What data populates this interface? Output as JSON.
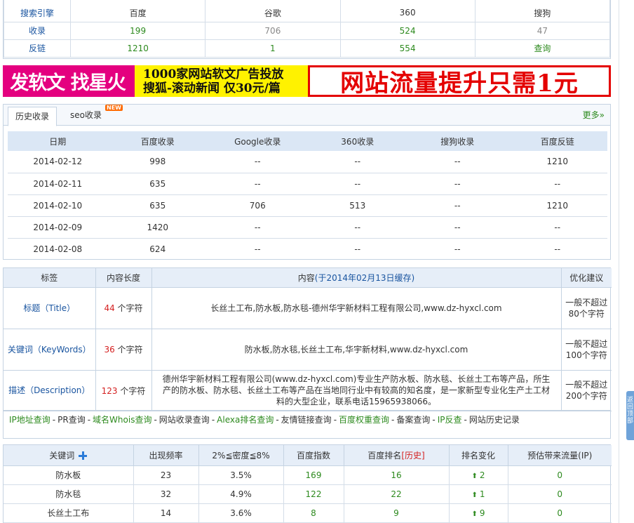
{
  "top_stats": {
    "headers": [
      "搜索引擎",
      "百度",
      "谷歌",
      "360",
      "搜狗"
    ],
    "index_row": {
      "label": "收录",
      "values": [
        "199",
        "706",
        "524",
        "47"
      ]
    },
    "backlink_row": {
      "label": "反链",
      "values": [
        "1210",
        "1",
        "554",
        "查询"
      ]
    }
  },
  "banner": {
    "left_text": "发软文 找星火",
    "mid_line1": "1000家网站软文广告投放",
    "mid_line2": "搜狐-滚动新闻 仅30元/篇",
    "right_text": "网站流量提升只需1元"
  },
  "history": {
    "tabs": [
      "历史收录",
      "seo收录"
    ],
    "new_badge": "NEW",
    "more": "更多»",
    "columns": [
      "日期",
      "百度收录",
      "Google收录",
      "360收录",
      "搜狗收录",
      "百度反链"
    ],
    "rows": [
      [
        "2014-02-12",
        "998",
        "--",
        "--",
        "--",
        "1210"
      ],
      [
        "2014-02-11",
        "635",
        "--",
        "--",
        "--",
        "--"
      ],
      [
        "2014-02-10",
        "635",
        "706",
        "513",
        "--",
        "1210"
      ],
      [
        "2014-02-09",
        "1420",
        "--",
        "--",
        "--",
        "--"
      ],
      [
        "2014-02-08",
        "624",
        "--",
        "--",
        "--",
        "--"
      ]
    ]
  },
  "meta": {
    "col_tag": "标签",
    "col_len": "内容长度",
    "col_content_prefix": "内容",
    "col_content_cache": "(于2014年02月13日缓存)",
    "col_suggest": "优化建议",
    "unit": "个字符",
    "rows": [
      {
        "tag": "标题（Title）",
        "len": "44",
        "content": "长丝土工布,防水板,防水毯-德州华宇新材料工程有限公司,www.dz-hyxcl.com",
        "suggest": "一般不超过80个字符"
      },
      {
        "tag": "关键词（KeyWords）",
        "len": "36",
        "content": "防水板,防水毯,长丝土工布,华宇新材料,www.dz-hyxcl.com",
        "suggest": "一般不超过100个字符"
      },
      {
        "tag": "描述（Description）",
        "len": "123",
        "content": "德州华宇新材料工程有限公司(www.dz-hyxcl.com)专业生产防水板、防水毯、长丝土工布等产品，所生产的防水板、防水毯、长丝土工布等产品在当地同行业中有较高的知名度，是一家新型专业化生产土工材料的大型企业，联系电话15965938066。",
        "suggest": "一般不超过200个字符"
      }
    ]
  },
  "links": [
    "IP地址查询",
    "PR查询",
    "域名Whois查询",
    "网站收录查询",
    "Alexa排名查询",
    "友情链接查询",
    "百度权重查询",
    "备案查询",
    "IP反查",
    "网站历史记录"
  ],
  "keywords": {
    "col_keyword": "关键词",
    "col_freq": "出现频率",
    "col_density": "2%≦密度≦8%",
    "col_bindex": "百度指数",
    "col_brank_prefix": "百度排名",
    "col_brank_link": "[历史]",
    "col_change": "排名变化",
    "col_traffic": "预估带来流量(IP)",
    "rows": [
      {
        "kw": "防水板",
        "freq": "23",
        "density": "3.5%",
        "bindex": "169",
        "rank": "16",
        "change": "2",
        "traffic": "0"
      },
      {
        "kw": "防水毯",
        "freq": "32",
        "density": "4.9%",
        "bindex": "122",
        "rank": "22",
        "change": "1",
        "traffic": "0"
      },
      {
        "kw": "长丝土工布",
        "freq": "14",
        "density": "3.6%",
        "bindex": "8",
        "rank": "9",
        "change": "9",
        "traffic": "0"
      }
    ]
  },
  "side_tab": "返回顶部"
}
